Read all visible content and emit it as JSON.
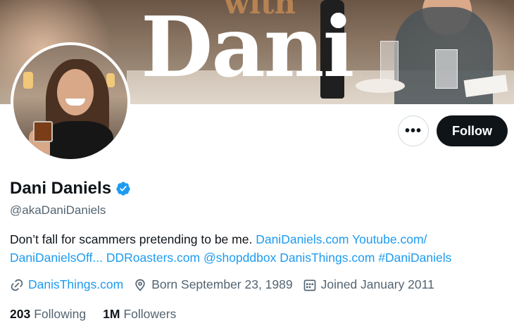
{
  "banner": {
    "subtitle": "with",
    "title": "Dani"
  },
  "profile": {
    "display_name": "Dani Daniels",
    "handle": "@akaDaniDaniels",
    "verified": true,
    "bio_text": "Don’t fall for scammers pretending to be me.",
    "bio_links": [
      "DaniDaniels.com",
      "Youtube.com/",
      "DaniDanielsOff...",
      "DDRoasters.com",
      "@shopddbox",
      "DanisThings.com",
      "#DaniDaniels"
    ],
    "website": "DanisThings.com",
    "birth": "Born September 23, 1989",
    "joined": "Joined January 2011"
  },
  "stats": {
    "following_count": "203",
    "following_label": "Following",
    "followers_count": "1M",
    "followers_label": "Followers"
  },
  "actions": {
    "more_label": "•••",
    "follow_label": "Follow"
  },
  "colors": {
    "accent": "#1d9bf0",
    "text_primary": "#0f1419",
    "text_secondary": "#536471",
    "follow_bg": "#0f1419"
  },
  "icons": {
    "verified": "verified-badge-icon",
    "link": "link-icon",
    "location": "birthday-pin-icon",
    "calendar": "calendar-icon",
    "more": "more-icon"
  }
}
